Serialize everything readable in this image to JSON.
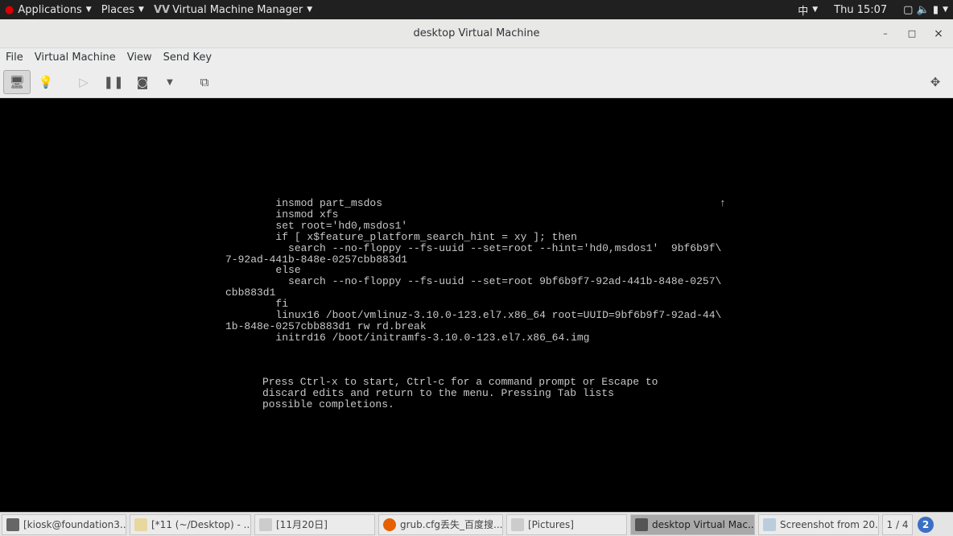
{
  "topbar": {
    "applications": "Applications",
    "places": "Places",
    "app_name": "Virtual Machine Manager",
    "input_method": "中",
    "clock": "Thu 15:07"
  },
  "window": {
    "title": "desktop Virtual Machine",
    "minimize": "–",
    "maximize": "□",
    "close": "×"
  },
  "menu": [
    "File",
    "Virtual Machine",
    "View",
    "Send Key"
  ],
  "console": {
    "lines": "        insmod part_msdos\n        insmod xfs\n        set root='hd0,msdos1'\n        if [ x$feature_platform_search_hint = xy ]; then\n          search --no-floppy --fs-uuid --set=root --hint='hd0,msdos1'  9bf6b9f\\\n7-92ad-441b-848e-0257cbb883d1\n        else\n          search --no-floppy --fs-uuid --set=root 9bf6b9f7-92ad-441b-848e-0257\\\ncbb883d1\n        fi\n        linux16 /boot/vmlinuz-3.10.0-123.el7.x86_64 root=UUID=9bf6b9f7-92ad-44\\\n1b-848e-0257cbb883d1 rw rd.break\n        initrd16 /boot/initramfs-3.10.0-123.el7.x86_64.img",
    "scroll_indicator": "↑",
    "help": "Press Ctrl-x to start, Ctrl-c for a command prompt or Escape to\ndiscard edits and return to the menu. Pressing Tab lists\npossible completions."
  },
  "taskbar": {
    "items": [
      {
        "label": "[kiosk@foundation3...",
        "icon": "terminal-icon"
      },
      {
        "label": "[*11 (~/Desktop) - ...",
        "icon": "text-editor-icon"
      },
      {
        "label": "[11月20日]",
        "icon": "folder-icon"
      },
      {
        "label": "grub.cfg丢失_百度搜...",
        "icon": "firefox-icon"
      },
      {
        "label": "[Pictures]",
        "icon": "folder-icon"
      },
      {
        "label": "desktop Virtual Mac...",
        "icon": "virt-manager-icon",
        "active": true
      },
      {
        "label": "Screenshot from 20...",
        "icon": "screenshot-icon"
      }
    ],
    "workspace": "1 / 4",
    "notifications": "2"
  }
}
